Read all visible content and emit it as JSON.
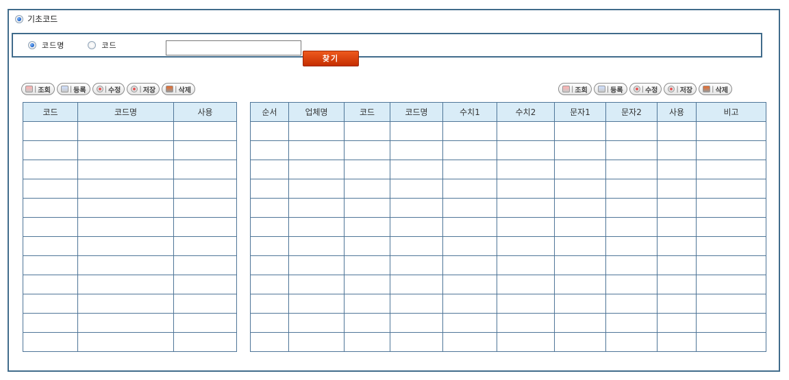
{
  "title": "기초코드",
  "search": {
    "options": [
      {
        "label": "코드명",
        "selected": true
      },
      {
        "label": "코드",
        "selected": false
      }
    ],
    "input_value": "",
    "find_label": "찾기"
  },
  "toolbar": {
    "buttons": [
      {
        "label": "조회",
        "icon": "search-icon"
      },
      {
        "label": "등록",
        "icon": "add-icon"
      },
      {
        "label": "수정",
        "icon": "edit-icon"
      },
      {
        "label": "저장",
        "icon": "save-icon"
      },
      {
        "label": "삭제",
        "icon": "delete-icon"
      }
    ]
  },
  "left_table": {
    "headers": [
      "코드",
      "코드명",
      "사용"
    ],
    "row_count": 12
  },
  "right_table": {
    "headers": [
      "순서",
      "업체명",
      "코드",
      "코드명",
      "수치1",
      "수치2",
      "문자1",
      "문자2",
      "사용",
      "비고"
    ],
    "row_count": 12
  },
  "colors": {
    "frame_border": "#3f6a8a",
    "header_bg": "#d9ecf7",
    "find_button": "#d94010"
  }
}
